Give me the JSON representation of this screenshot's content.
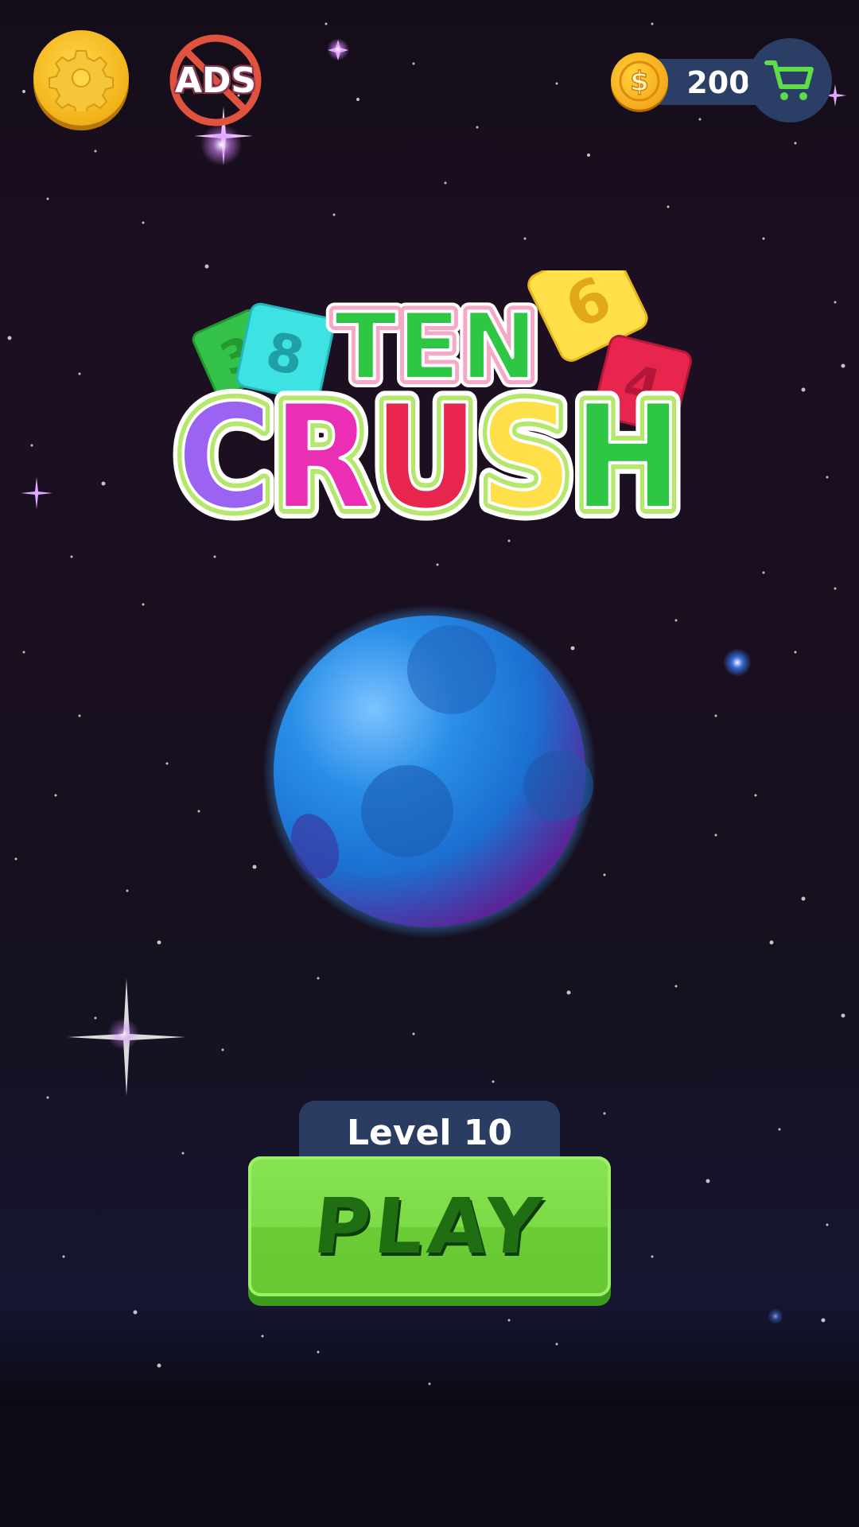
{
  "top_bar": {
    "settings_icon": "gear-icon",
    "no_ads_label": "ADS",
    "no_ads_icon": "no-ads-icon",
    "coin_icon": "dollar-coin-icon",
    "coins": "200",
    "cart_icon": "shopping-cart-icon"
  },
  "logo": {
    "line1": "TEN",
    "line2": "CRUSH",
    "tiles": [
      "3",
      "8",
      "6",
      "4"
    ]
  },
  "level": {
    "label": "Level 10"
  },
  "play_button": {
    "label": "PLAY"
  },
  "colors": {
    "gold": "#f2b21a",
    "navy_panel": "#2b3e66",
    "play_green": "#7ddb48",
    "play_text": "#1f6e12",
    "cart_green": "#5fdc4a",
    "planet_blue": "#1e88e5"
  }
}
